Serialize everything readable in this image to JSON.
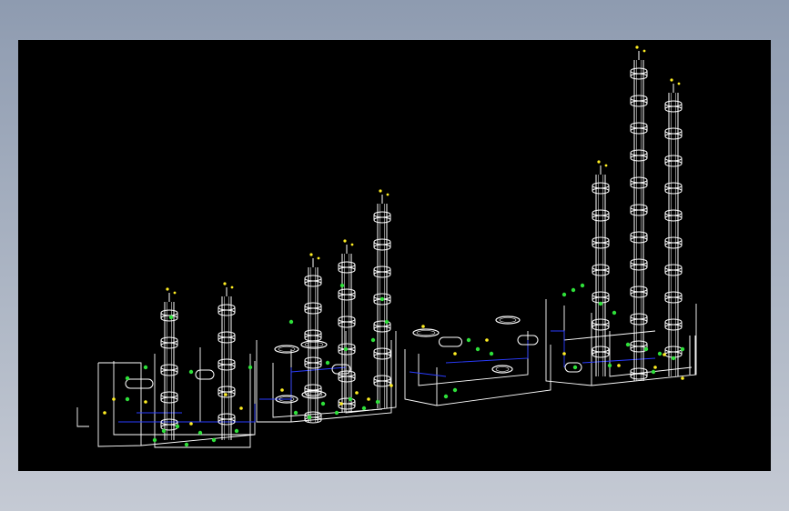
{
  "scene": {
    "background_color": "#000000",
    "wire_color": "#ffffff",
    "blue_color": "#2a3cff",
    "green_color": "#2ee03a",
    "yellow_color": "#ffee22",
    "columns_visible": 11,
    "units_visible": 4
  }
}
